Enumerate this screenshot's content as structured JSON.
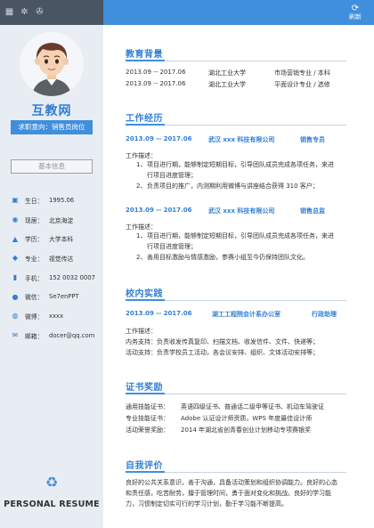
{
  "toolbar": {
    "icons": [
      "doc-icon",
      "gear-icon",
      "share-icon"
    ],
    "refresh_symbol": "⟳",
    "refresh_label": "刷新"
  },
  "profile": {
    "name": "互教网",
    "intent": "求职意向：销售员岗位",
    "basic_title": "基本信息",
    "info": [
      {
        "icon": "cake-icon",
        "key": "生日：",
        "value": "1995.06"
      },
      {
        "icon": "location-icon",
        "key": "现居：",
        "value": "北京海淀"
      },
      {
        "icon": "graduation-icon",
        "key": "学历：",
        "value": "大学本科"
      },
      {
        "icon": "book-icon",
        "key": "专业：",
        "value": "视觉传达"
      },
      {
        "icon": "phone-icon",
        "key": "手机：",
        "value": "152 0032 0007"
      },
      {
        "icon": "wechat-icon",
        "key": "微信：",
        "value": "Se7enPPT"
      },
      {
        "icon": "weibo-icon",
        "key": "微博：",
        "value": "xxxx"
      },
      {
        "icon": "mail-icon",
        "key": "邮箱：",
        "value": "docer@qq.com"
      }
    ],
    "footer": "PERSONAL RESUME"
  },
  "education": {
    "title": "教育背景",
    "rows": [
      {
        "period": "2013.09 -- 2017.06",
        "school": "湖北工业大学",
        "major": "市场营销专业 / 本科"
      },
      {
        "period": "2013.09 -- 2017.06",
        "school": "湖北工业大学",
        "major": "平面设计专业 / 选修"
      }
    ]
  },
  "work": {
    "title": "工作经历",
    "jobs": [
      {
        "period": "2013.09 -- 2017.06",
        "company": "武汉 xxx 科技有限公司",
        "role": "销售专员",
        "desc_label": "工作描述：",
        "items": [
          {
            "n": "1、",
            "text": "项目进行期，能够制定短期目标，引导团队成员完成各项任务，来进行项目进度管理；"
          },
          {
            "n": "2、",
            "text": "负责项目的推广，内测期利用微博与讲座结合获得 310 客户；"
          }
        ]
      },
      {
        "period": "2013.09 -- 2017.06",
        "company": "武汉 xxx 科技有限公司",
        "role": "销售总监",
        "desc_label": "工作描述：",
        "items": [
          {
            "n": "1、",
            "text": "项目进行期，能够制定短期目标，引导团队成员完成各项任务，来进行项目进度管理；"
          },
          {
            "n": "2、",
            "text": "善用目标激励与情感激励，参赛小组至今仍保持团队文化。"
          }
        ]
      }
    ]
  },
  "campus": {
    "title": "校内实践",
    "period": "2013.09 -- 2017.06",
    "org": "湖工工程院会计系办公室",
    "role": "行政助理",
    "desc_label": "工作描述：",
    "lines": [
      "内务支持：负责收发传真复印、扫描文档、收发信件、文件、快递等；",
      "活动支持：负责学校员工活动，各会议安排、组织、文体活动安排等；"
    ]
  },
  "certs": {
    "title": "证书奖励",
    "rows": [
      {
        "key": "通用技能证书：",
        "value": "英语四级证书、普通话二级甲等证书、机动车驾驶证"
      },
      {
        "key": "专业技能证书：",
        "value": "Adobe 认证设计师资质，WPS 年度最佳设计师"
      },
      {
        "key": "活动荣誉奖励：",
        "value": "2014 年湖北省创青春创业计划移动专项赛银奖"
      }
    ]
  },
  "self_eval": {
    "title": "自我评价",
    "text": "良好的公共关系意识，善于沟通，具备活动策划和组织协调能力。良好的心态和责任感，吃苦耐劳，擅于管理时间，勇于面对变化和挑战。良好的学习能力，习惯制定切实可行的学习计划，勤于学习能不断提高。"
  },
  "colors": {
    "accent": "#3f8fdd",
    "sidebar": "#e8edf3",
    "topbar": "#4a5564"
  }
}
